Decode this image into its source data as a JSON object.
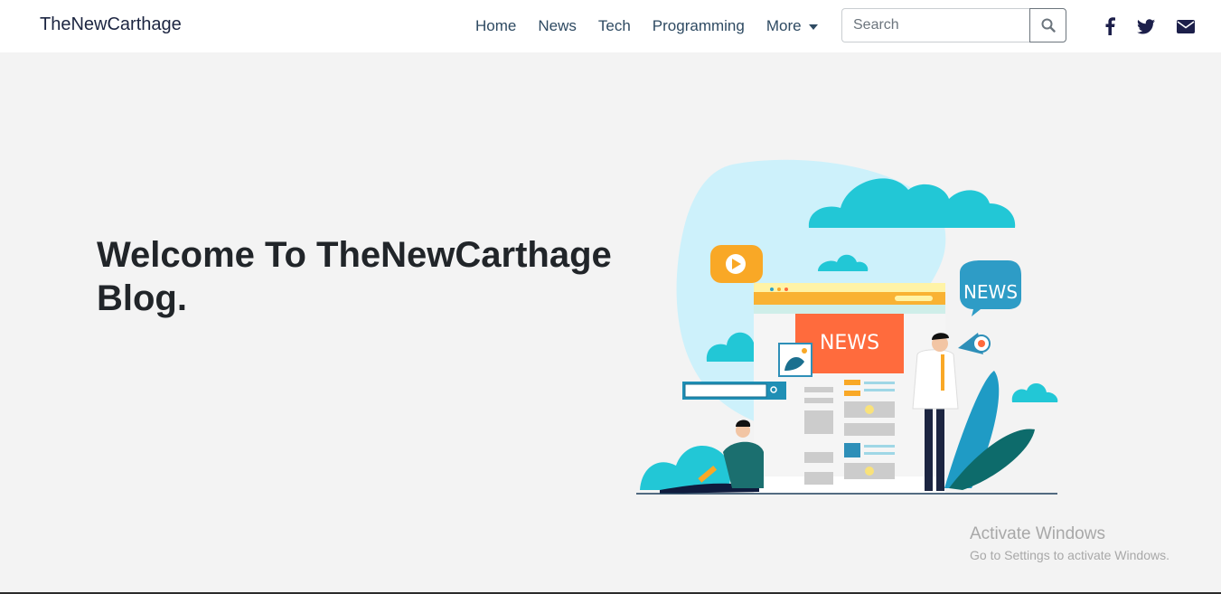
{
  "navbar": {
    "brand": "TheNewCarthage",
    "links": [
      {
        "label": "Home"
      },
      {
        "label": "News"
      },
      {
        "label": "Tech"
      },
      {
        "label": "Programming"
      },
      {
        "label": "More"
      }
    ],
    "search": {
      "placeholder": "Search",
      "value": "",
      "button_icon": "search-icon"
    },
    "social_icons": [
      "facebook-icon",
      "twitter-icon",
      "envelope-icon"
    ]
  },
  "hero": {
    "title": "Welcome To TheNewCarthage Blog.",
    "illustration": {
      "news_banner": "NEWS",
      "speech_bubble": "NEWS"
    }
  },
  "watermark": {
    "title": "Activate Windows",
    "subtitle": "Go to Settings to activate Windows."
  },
  "colors": {
    "brand_text": "#1c2541",
    "nav_text": "#2e4a62",
    "background": "#f3f3f3",
    "accent_orange": "#ff6b3d",
    "accent_teal": "#26c6d4",
    "accent_yellow": "#f9a826"
  }
}
